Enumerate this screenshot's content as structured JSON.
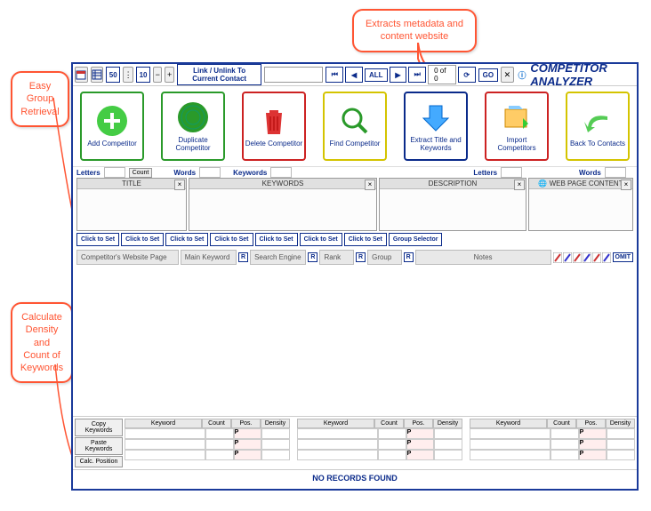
{
  "app_title": "COMPETITOR ANALYZER",
  "callouts": {
    "top": "Extracts metadata and content website",
    "left": "Easy Group Retrieval",
    "bottom": "Calculate Density and Count of Keywords"
  },
  "topbar": {
    "n1": "50",
    "n2": "10",
    "link_btn": "Link / Unlink To Current Contact",
    "all_btn": "ALL",
    "counter": "0 of 0",
    "go": "GO"
  },
  "toolbar": [
    {
      "label": "Add Competitor",
      "name": "add-competitor",
      "color": "#2a9a2a"
    },
    {
      "label": "Duplicate Competitor",
      "name": "duplicate-competitor",
      "color": "#2a9a2a"
    },
    {
      "label": "Delete Competitor",
      "name": "delete-competitor",
      "color": "#cc2222"
    },
    {
      "label": "Find Competitor",
      "name": "find-competitor",
      "color": "#d4c400"
    },
    {
      "label": "Extract Title and Keywords",
      "name": "extract",
      "color": "#0a2a8a"
    },
    {
      "label": "Import Competitors",
      "name": "import",
      "color": "#cc2222"
    },
    {
      "label": "Back To Contacts",
      "name": "back",
      "color": "#d4c400"
    }
  ],
  "row_labels": {
    "letters": "Letters",
    "count": "Count",
    "words": "Words",
    "keywords": "Keywords"
  },
  "panels": {
    "title": "TITLE",
    "keywords": "KEYWORDS",
    "description": "DESCRIPTION",
    "webpage": "WEB PAGE CONTENT",
    "globe": "globe"
  },
  "clickbtns": [
    "Click to Set",
    "Click to Set",
    "Click to Set",
    "Click to Set",
    "Click to Set",
    "Click to Set",
    "Click to Set",
    "Group Selector"
  ],
  "fields": {
    "f1": "Competitor's Website Page",
    "f2": "Main Keyword",
    "f3": "Search Engine",
    "f4": "Rank",
    "f5": "Group",
    "notes": "Notes",
    "r": "R",
    "omit": "OMIT"
  },
  "kwside": [
    "Copy Keywords",
    "Paste Keywords",
    "Calc. Position"
  ],
  "kwcols": {
    "keyword": "Keyword",
    "count": "Count",
    "pos": "Pos.",
    "density": "Density",
    "p": "P"
  },
  "footer": "NO RECORDS FOUND"
}
